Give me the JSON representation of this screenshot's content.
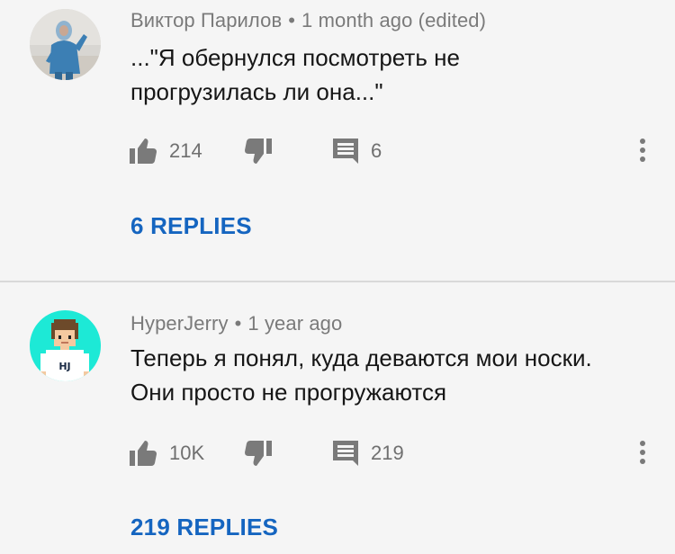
{
  "comments": [
    {
      "author": "Виктор Парилов",
      "separator": "•",
      "time": "1 month ago (edited)",
      "text_lines": [
        "...\"Я обернулся посмотреть не",
        "прогрузилась ли она...\""
      ],
      "likes": "214",
      "replies_count": "6",
      "replies_link": "6 REPLIES",
      "avatar": "photo-avatar"
    },
    {
      "author": "HyperJerry",
      "separator": "•",
      "time": "1 year ago",
      "text_lines": [
        "Теперь я понял, куда деваются мои носки.",
        "Они просто не прогружаются"
      ],
      "likes": "10K",
      "replies_count": "219",
      "replies_link": "219 REPLIES",
      "avatar": "pixel-art-avatar",
      "avatar_badge": "HJ"
    }
  ],
  "colors": {
    "background": "#f5f5f5",
    "link": "#1565c0",
    "icon": "#7a7a7a",
    "avatar2_bg": "#1de9d6"
  },
  "icons": {
    "like": "thumbs-up-icon",
    "dislike": "thumbs-down-icon",
    "reply": "comment-icon",
    "more": "more-vertical-icon"
  }
}
